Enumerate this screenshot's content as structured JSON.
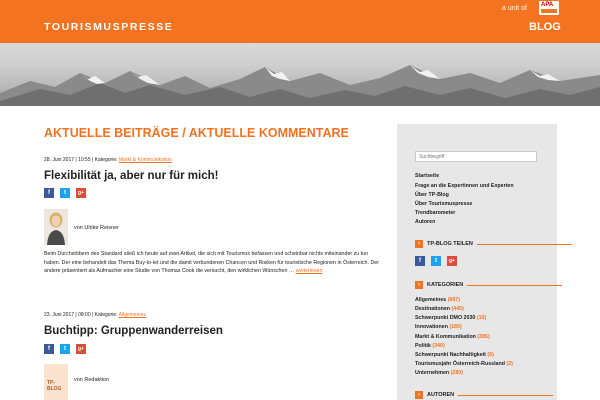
{
  "header": {
    "logo": "TOURISMUSPRESSE",
    "unit_text": "a unit of",
    "badge_text": "APA",
    "blog_link": "BLOG"
  },
  "main": {
    "section_title_left": "AKTUELLE BEITRÄGE",
    "section_separator": " / ",
    "section_title_right": "AKTUELLE KOMMENTARE",
    "posts": [
      {
        "date": "28. Juni 2017",
        "time": "10:55",
        "category_label": "Kategorie:",
        "category": "Markt & Kommunikation",
        "title": "Flexibilität ja, aber nur für mich!",
        "author": "von Ulrike Reisner",
        "excerpt": "Beim Durchstöbern des Standard stieß ich heute auf zwei Artikel, die sich mit Tourismus befassen und scheinbar nichts miteinander zu tun haben. Der eine behandelt das Thema Buy-to-let und die damit verbundenen Chancen und Risiken für touristische Regionen in Österreich. Der andere präsentiert als Aufmacher eine Studie von Thomas Cook die versucht, den wirklichen Wünschen … ",
        "more": "weiterlesen"
      },
      {
        "date": "23. Juni 2017",
        "time": "08:00",
        "category_label": "Kategorie:",
        "category": "Allgemeines",
        "title": "Buchtipp: Gruppenwanderreisen",
        "author": "von Redaktion",
        "logo_text": "TP-BLOG"
      }
    ],
    "share_icons": [
      "facebook-icon",
      "twitter-icon",
      "google-plus-icon"
    ]
  },
  "sidebar": {
    "search_placeholder": "Suchbegriff",
    "links": [
      "Startseite",
      "Frage an die Expertinnen und Experten",
      "Über TP-Blog",
      "Über Tourismuspresse",
      "Trendbarometer",
      "Autoren"
    ],
    "share_heading": "TP-BLOG TEILEN",
    "categories_heading": "KATEGORIEN",
    "categories": [
      {
        "name": "Allgemeines",
        "count": "(687)"
      },
      {
        "name": "Destinationen",
        "count": "(445)"
      },
      {
        "name": "Schwerpunkt DMO 2030",
        "count": "(10)"
      },
      {
        "name": "Innovationen",
        "count": "(185)"
      },
      {
        "name": "Markt & Kommunikation",
        "count": "(385)"
      },
      {
        "name": "Politik",
        "count": "(340)"
      },
      {
        "name": "Schwerpunkt Nachhaltigkeit",
        "count": "(6)"
      },
      {
        "name": "Tourismusjahr Österreich-Russland",
        "count": "(2)"
      },
      {
        "name": "Unternehmen",
        "count": "(280)"
      }
    ],
    "authors_heading": "AUTOREN"
  },
  "colors": {
    "accent": "#f37321",
    "sidebar_bg": "#e7e7e7",
    "facebook": "#3b5998",
    "twitter": "#1da1f2",
    "google_plus": "#dd4b39"
  }
}
